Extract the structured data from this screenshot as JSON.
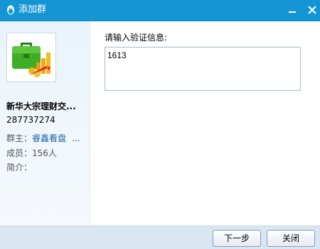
{
  "window": {
    "title": "添加群",
    "icon": "qq-penguin-icon",
    "minimize_glyph": "—",
    "close_glyph": "✕"
  },
  "group": {
    "name": "新华大宗理财交...",
    "id": "287737274",
    "owner_label": "群主：",
    "owner_name": "睿鑫看盘",
    "owner_more": "...",
    "members_label": "成员：",
    "members_value": "156人",
    "intro_label": "简介：",
    "intro_value": ""
  },
  "verify": {
    "label": "请输入验证信息:",
    "value": "1613"
  },
  "buttons": {
    "next": "下一步",
    "close": "关闭"
  },
  "colors": {
    "titlebar": "#1596d4",
    "footer": "#d9e7f3",
    "link": "#1a5fa8"
  }
}
